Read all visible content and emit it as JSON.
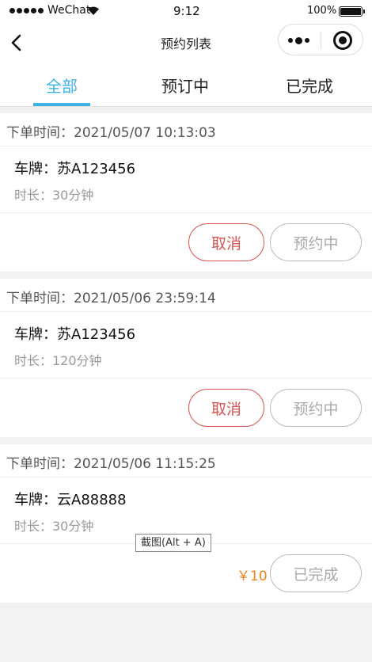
{
  "status_bar": {
    "carrier": "WeChat",
    "time": "9:12",
    "battery": "100%"
  },
  "nav": {
    "title": "预约列表"
  },
  "tabs": [
    {
      "label": "全部",
      "active": true
    },
    {
      "label": "预订中",
      "active": false
    },
    {
      "label": "已完成",
      "active": false
    }
  ],
  "orders": [
    {
      "order_time": "下单时间：2021/05/07 10:13:03",
      "plate": "车牌：苏A123456",
      "duration": "时长：30分钟",
      "cancel_label": "取消",
      "status_label": "预约中"
    },
    {
      "order_time": "下单时间：2021/05/06 23:59:14",
      "plate": "车牌：苏A123456",
      "duration": "时长：120分钟",
      "cancel_label": "取消",
      "status_label": "预约中"
    },
    {
      "order_time": "下单时间：2021/05/06 11:15:25",
      "plate": "车牌：云A88888",
      "duration": "时长：30分钟",
      "price": "￥10",
      "status_label": "已完成"
    }
  ],
  "tooltip": "截图(Alt + A)",
  "colors": {
    "accent": "#3cb4e7",
    "cancel": "#d9534f",
    "price": "#f0831e"
  }
}
